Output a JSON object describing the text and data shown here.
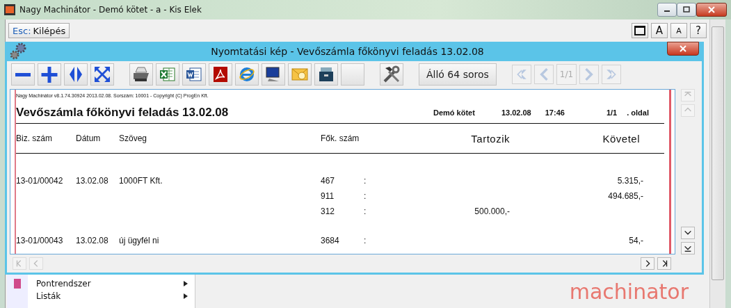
{
  "window": {
    "title": "Nagy Machinátor - Demó kötet - a - Kis Elek"
  },
  "toolbar": {
    "exit_button": {
      "key": "Esc:",
      "label": "Kilépés"
    },
    "right_buttons": [
      {
        "kind": "window"
      },
      {
        "kind": "large",
        "label": "A"
      },
      {
        "kind": "small",
        "label": "A"
      },
      {
        "kind": "large",
        "label": "?"
      }
    ]
  },
  "dialog": {
    "title": "Nyomtatási kép - Vevőszámla főkönyvi feladás 13.02.08",
    "tools": [
      {
        "kind": "minus"
      },
      {
        "kind": "plus"
      },
      {
        "kind": "fit-width"
      },
      {
        "kind": "fit-page"
      },
      {
        "kind": "gap"
      },
      {
        "kind": "printer"
      },
      {
        "kind": "excel"
      },
      {
        "kind": "word"
      },
      {
        "kind": "pdf"
      },
      {
        "kind": "browser"
      },
      {
        "kind": "monitor"
      },
      {
        "kind": "email"
      },
      {
        "kind": "archive"
      },
      {
        "kind": "blank"
      },
      {
        "kind": "gap"
      },
      {
        "kind": "tools"
      }
    ],
    "orientation_button": "Álló 64 soros",
    "pager": {
      "page": "1/1"
    },
    "report": {
      "meta": "Nagy Machinátor v8.1.74.30924 2013.02.08. Sorszám: 10001 - Copyright (C) ProgEn Kft.",
      "title": "Vevőszámla főkönyvi feladás 13.02.08",
      "header": [
        "Demó kötet",
        "13.02.08",
        "17:46",
        "1/1",
        ". oldal"
      ],
      "columns": [
        "Biz. szám",
        "Dátum",
        "Szöveg",
        "Fők. szám",
        "Tartozik",
        "Követel"
      ],
      "rows": [
        {
          "doc": "13-01/00042",
          "date": "13.02.08",
          "text": "1000FT Kft.",
          "lines": [
            {
              "account": "467",
              "sep": ":",
              "credit": "5.315,-"
            },
            {
              "account": "911",
              "sep": ":",
              "credit": "494.685,-"
            },
            {
              "account": "312",
              "sep": ":",
              "debit": "500.000,-"
            }
          ]
        },
        {
          "doc": "13-01/00043",
          "date": "13.02.08",
          "text": "új ügyfél ni",
          "lines": [
            {
              "account": "3684",
              "sep": ":",
              "credit": "54,-"
            }
          ]
        }
      ]
    }
  },
  "menu": [
    {
      "label": "Pontrendszer",
      "submenu": true
    },
    {
      "label": "Listák",
      "submenu": true
    }
  ],
  "logo": "machinator"
}
